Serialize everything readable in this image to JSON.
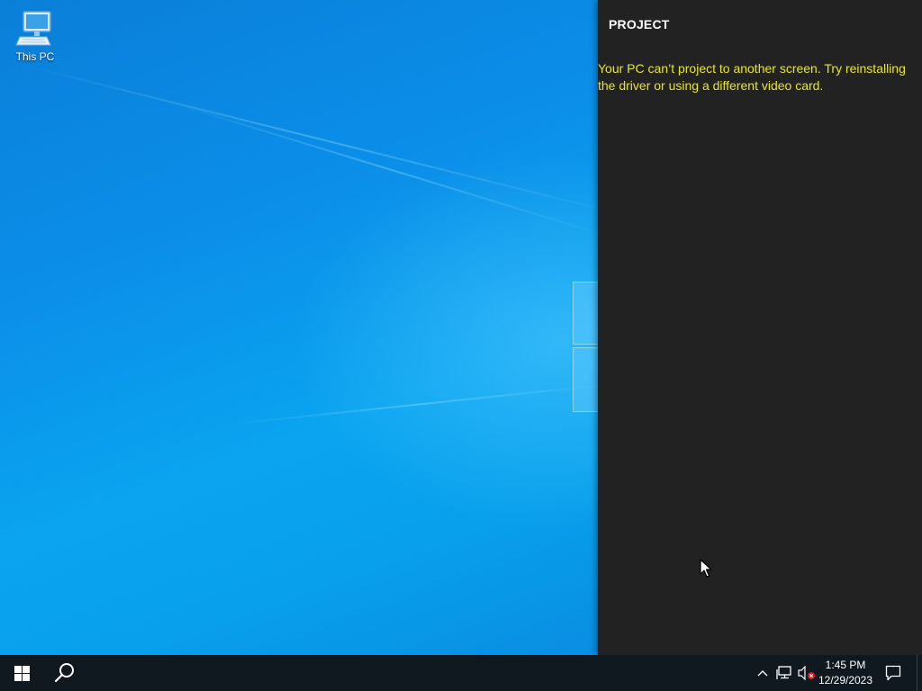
{
  "desktop": {
    "icons": [
      {
        "label": "This PC",
        "icon": "computer-icon"
      }
    ]
  },
  "project_panel": {
    "title": "PROJECT",
    "message": "Your PC can’t project to another screen. Try reinstalling the driver or using a different video card.",
    "message_color": "#e6e62a",
    "background": "#222222"
  },
  "taskbar": {
    "start_icon": "windows-logo-icon",
    "search_icon": "search-icon",
    "tray": {
      "chevron_icon": "chevron-up-icon",
      "network_icon": "network-icon",
      "volume_icon": "volume-muted-icon"
    },
    "clock": {
      "time": "1:45 PM",
      "date": "12/29/2023"
    },
    "notification_icon": "action-center-icon",
    "background": "#101820"
  },
  "colors": {
    "desktop_blue": "#0a8fe6"
  }
}
